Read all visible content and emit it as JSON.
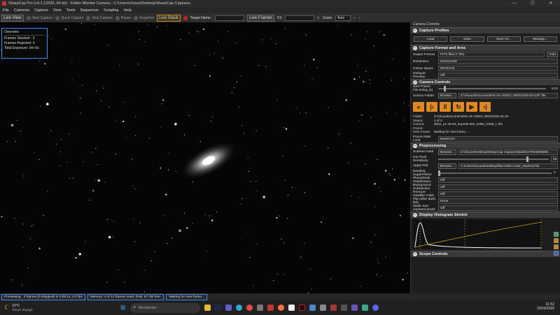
{
  "window": {
    "title": "SharpCap Pro (v4.1.12693, 64 bit) - Folder Monitor Camera - C:\\Users\\chuuu\\Desktop\\SharpCap Captures",
    "min": "—",
    "max": "☐",
    "close": "✕"
  },
  "menu": [
    "File",
    "Cameras",
    "Capture",
    "View",
    "Tools",
    "Sequencer",
    "Scripting",
    "Help"
  ],
  "toolbar": {
    "live_view": "Live View",
    "start_capture": "Start Capture",
    "quick_capture": "Quick Capture",
    "stop_capture": "Stop Capture",
    "pause": "Pause",
    "snapshot": "Snapshot",
    "live_stack": "Live Stack",
    "target_name": "Target Name :",
    "live_frames": "Live Frames",
    "fx": "FX",
    "zoom": "Zoom:",
    "zoom_value": "Auto"
  },
  "overview": {
    "title": "Overview",
    "stacked": "Frames Stacked : 3",
    "rejected": "Frames Rejected: 0",
    "exposure": "Total Exposure:  9m 0s"
  },
  "panel": {
    "title": "Camera Controls",
    "capture_profiles": {
      "title": "Capture Profiles",
      "load": "Load",
      "save": "Save",
      "save_as": "Save As...",
      "manage": "Manage..."
    },
    "format": {
      "title": "Capture Format and Area",
      "output_format_label": "Output Format",
      "output_format": "FITS files (*.fits)",
      "auto": "Auto",
      "resolution_label": "Resolution",
      "resolution": "6224x4168",
      "colour_space_label": "Colour Space",
      "colour_space": "MONO16",
      "debayer_label": "Debayer Preview",
      "debayer": "Off"
    },
    "camera": {
      "title": "Camera Controls",
      "new_frame_label": "New Frame File Delay (s)",
      "new_frame_value": "5.00",
      "source_label": "Source Folder",
      "browse": "Browse...",
      "source_value": "Z:\\chuuu\\Documents\\N.I.N.A\\NGC 2903\\2026-03-23\\*.fits",
      "folder_k": "Folder:",
      "folder_v": "Z:\\chuuu\\Documents\\N.I.N.A\\NGC 2903\\2026-03-23",
      "status_k": "Status:",
      "status_v": "3 of 3",
      "current_k": "Current Frame:",
      "current_v": "0002_21-46-53_Exp180.00s_G300_O305_L.fits",
      "next_k": "Next Frame:",
      "next_v": "Waiting for next frame...",
      "frame_rate_label": "Frame Rate Limit",
      "frame_rate": "Maximum"
    },
    "pre": {
      "title": "Preprocessing",
      "dark_label": "Subtract Dark",
      "dark_value": "Z:\\chuuu\\Desktop\\SharpCap Captures\\darks\\ATR2600M\\M...",
      "hot_label": "Hot Pixel Sensitivity",
      "hot_value": "25",
      "flat_label": "Apply Flat",
      "flat_value": "C:\\Users\\chuuu\\Desktop\\flat G300 C11E_stacked.fits",
      "banding_label": "Banding Suppression",
      "banding_value": "0",
      "planet_label": "Planet/Disk Stabilization",
      "planet_value": "Off",
      "bg_label": "Background Subtraction",
      "bg_value": "Off",
      "sat_label": "Remove Satellite Trails",
      "sat_value": "Off",
      "flip_label": "Flip (after dark/ flat)",
      "flip_value": "None",
      "mask_label": "Mask over exposed pixels",
      "mask_value": "Off"
    },
    "hist": {
      "title": "Display Histogram Stretch"
    },
    "scope": {
      "title": "Scope Controls"
    }
  },
  "status": {
    "s1": "Previewing : 3 frames (0 dropped) in 0:05:14, 0.0 fps",
    "s2": "Memory: 4 of 41 frames used, Disk: 57 GB free.",
    "s3": "Waiting for next frame..."
  },
  "taskbar": {
    "temp": "10°C",
    "weather": "Temps dégagé",
    "search": "Rechercher",
    "time": "21:52",
    "date": "23/03/2026"
  }
}
